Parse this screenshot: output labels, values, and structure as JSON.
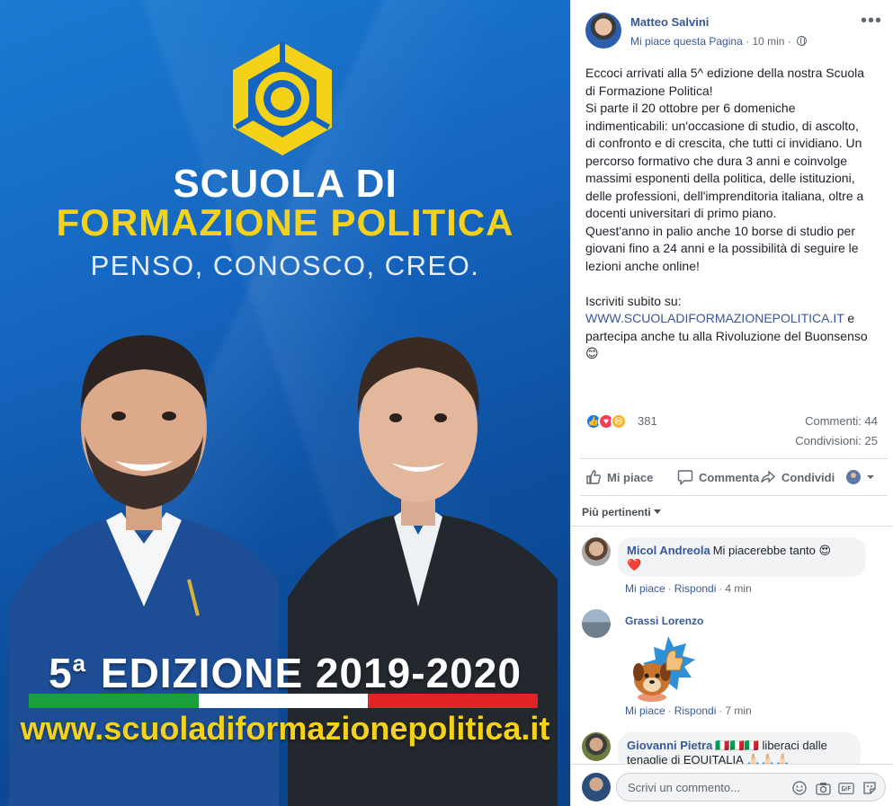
{
  "poster": {
    "title_line1": "SCUOLA DI",
    "title_line2": "FORMAZIONE POLITICA",
    "motto": "PENSO, CONOSCO, CREO.",
    "edition_num": "5",
    "edition_sup": "a",
    "edition_text": "EDIZIONE 2019-2020",
    "website": "www.scuoladiformazionepolitica.it",
    "colors": {
      "blue": "#1565c0",
      "yellow": "#f5d21a",
      "green": "#1aa03a",
      "red": "#e02424"
    }
  },
  "post": {
    "author": "Matteo Salvini",
    "page_like": "Mi piace questa Pagina",
    "time": "10 min",
    "more_icon": "more-icon",
    "body_lines": [
      "Eccoci arrivati alla 5^ edizione della nostra Scuola",
      "di Formazione Politica!",
      "Si parte il 20 ottobre per 6 domeniche",
      "indimenticabili: un'occasione di studio, di ascolto,",
      "di confronto e di crescita, che tutti ci invidiano. Un",
      "percorso formativo che dura 3 anni e coinvolge",
      "massimi esponenti della politica, delle istituzioni,",
      "delle professioni, dell'imprenditoria italiana, oltre a",
      "docenti universitari di primo piano.",
      "Quest'anno in palio anche 10 borse di studio per",
      "giovani fino a 24 anni e la possibilità di seguire le",
      "lezioni anche online!",
      "",
      "Iscriviti subito su:"
    ],
    "link": "WWW.SCUOLADIFORMAZIONEPOLITICA.IT",
    "after_link": " e",
    "closing": "partecipa anche tu alla Rivoluzione del Buonsenso",
    "emoji": "😊",
    "reactions_count": "381",
    "comments_count": "Commenti: 44",
    "shares_count": "Condivisioni: 25"
  },
  "actions": {
    "like": "Mi piace",
    "comment": "Commenta",
    "share": "Condividi"
  },
  "comments": {
    "sort_label": "Più pertinenti",
    "items": [
      {
        "name": "Micol Andreola",
        "text": "Mi piacerebbe tanto 😍",
        "text2": "❤️",
        "like": "Mi piace",
        "reply": "Rispondi",
        "time": "4 min"
      },
      {
        "name": "Grassi Lorenzo",
        "like": "Mi piace",
        "reply": "Rispondi",
        "time": "7 min"
      },
      {
        "name": "Giovanni Pietra",
        "text": "🇮🇹🇮🇹🇮🇹 liberaci dalle",
        "text2": "tenaglie di EQUITALIA 🙏🏻🙏🏻🙏🏻"
      }
    ]
  },
  "composer": {
    "placeholder": "Scrivi un commento..."
  }
}
